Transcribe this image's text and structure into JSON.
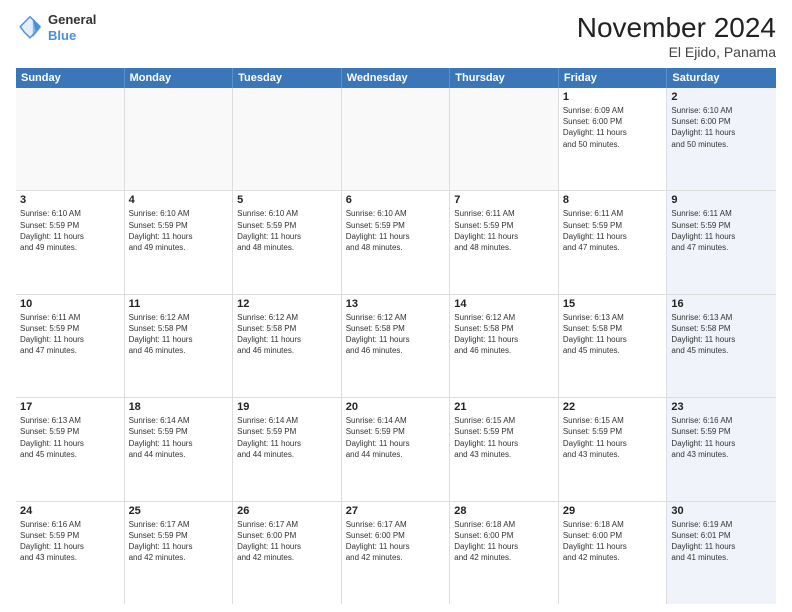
{
  "logo": {
    "general": "General",
    "blue": "Blue"
  },
  "header": {
    "month": "November 2024",
    "location": "El Ejido, Panama"
  },
  "weekdays": [
    "Sunday",
    "Monday",
    "Tuesday",
    "Wednesday",
    "Thursday",
    "Friday",
    "Saturday"
  ],
  "rows": [
    [
      {
        "day": "",
        "info": "",
        "empty": true
      },
      {
        "day": "",
        "info": "",
        "empty": true
      },
      {
        "day": "",
        "info": "",
        "empty": true
      },
      {
        "day": "",
        "info": "",
        "empty": true
      },
      {
        "day": "",
        "info": "",
        "empty": true
      },
      {
        "day": "1",
        "info": "Sunrise: 6:09 AM\nSunset: 6:00 PM\nDaylight: 11 hours\nand 50 minutes.",
        "empty": false
      },
      {
        "day": "2",
        "info": "Sunrise: 6:10 AM\nSunset: 6:00 PM\nDaylight: 11 hours\nand 50 minutes.",
        "empty": false,
        "alt": true
      }
    ],
    [
      {
        "day": "3",
        "info": "Sunrise: 6:10 AM\nSunset: 5:59 PM\nDaylight: 11 hours\nand 49 minutes.",
        "empty": false
      },
      {
        "day": "4",
        "info": "Sunrise: 6:10 AM\nSunset: 5:59 PM\nDaylight: 11 hours\nand 49 minutes.",
        "empty": false
      },
      {
        "day": "5",
        "info": "Sunrise: 6:10 AM\nSunset: 5:59 PM\nDaylight: 11 hours\nand 48 minutes.",
        "empty": false
      },
      {
        "day": "6",
        "info": "Sunrise: 6:10 AM\nSunset: 5:59 PM\nDaylight: 11 hours\nand 48 minutes.",
        "empty": false
      },
      {
        "day": "7",
        "info": "Sunrise: 6:11 AM\nSunset: 5:59 PM\nDaylight: 11 hours\nand 48 minutes.",
        "empty": false
      },
      {
        "day": "8",
        "info": "Sunrise: 6:11 AM\nSunset: 5:59 PM\nDaylight: 11 hours\nand 47 minutes.",
        "empty": false
      },
      {
        "day": "9",
        "info": "Sunrise: 6:11 AM\nSunset: 5:59 PM\nDaylight: 11 hours\nand 47 minutes.",
        "empty": false,
        "alt": true
      }
    ],
    [
      {
        "day": "10",
        "info": "Sunrise: 6:11 AM\nSunset: 5:59 PM\nDaylight: 11 hours\nand 47 minutes.",
        "empty": false
      },
      {
        "day": "11",
        "info": "Sunrise: 6:12 AM\nSunset: 5:58 PM\nDaylight: 11 hours\nand 46 minutes.",
        "empty": false
      },
      {
        "day": "12",
        "info": "Sunrise: 6:12 AM\nSunset: 5:58 PM\nDaylight: 11 hours\nand 46 minutes.",
        "empty": false
      },
      {
        "day": "13",
        "info": "Sunrise: 6:12 AM\nSunset: 5:58 PM\nDaylight: 11 hours\nand 46 minutes.",
        "empty": false
      },
      {
        "day": "14",
        "info": "Sunrise: 6:12 AM\nSunset: 5:58 PM\nDaylight: 11 hours\nand 46 minutes.",
        "empty": false
      },
      {
        "day": "15",
        "info": "Sunrise: 6:13 AM\nSunset: 5:58 PM\nDaylight: 11 hours\nand 45 minutes.",
        "empty": false
      },
      {
        "day": "16",
        "info": "Sunrise: 6:13 AM\nSunset: 5:58 PM\nDaylight: 11 hours\nand 45 minutes.",
        "empty": false,
        "alt": true
      }
    ],
    [
      {
        "day": "17",
        "info": "Sunrise: 6:13 AM\nSunset: 5:59 PM\nDaylight: 11 hours\nand 45 minutes.",
        "empty": false
      },
      {
        "day": "18",
        "info": "Sunrise: 6:14 AM\nSunset: 5:59 PM\nDaylight: 11 hours\nand 44 minutes.",
        "empty": false
      },
      {
        "day": "19",
        "info": "Sunrise: 6:14 AM\nSunset: 5:59 PM\nDaylight: 11 hours\nand 44 minutes.",
        "empty": false
      },
      {
        "day": "20",
        "info": "Sunrise: 6:14 AM\nSunset: 5:59 PM\nDaylight: 11 hours\nand 44 minutes.",
        "empty": false
      },
      {
        "day": "21",
        "info": "Sunrise: 6:15 AM\nSunset: 5:59 PM\nDaylight: 11 hours\nand 43 minutes.",
        "empty": false
      },
      {
        "day": "22",
        "info": "Sunrise: 6:15 AM\nSunset: 5:59 PM\nDaylight: 11 hours\nand 43 minutes.",
        "empty": false
      },
      {
        "day": "23",
        "info": "Sunrise: 6:16 AM\nSunset: 5:59 PM\nDaylight: 11 hours\nand 43 minutes.",
        "empty": false,
        "alt": true
      }
    ],
    [
      {
        "day": "24",
        "info": "Sunrise: 6:16 AM\nSunset: 5:59 PM\nDaylight: 11 hours\nand 43 minutes.",
        "empty": false
      },
      {
        "day": "25",
        "info": "Sunrise: 6:17 AM\nSunset: 5:59 PM\nDaylight: 11 hours\nand 42 minutes.",
        "empty": false
      },
      {
        "day": "26",
        "info": "Sunrise: 6:17 AM\nSunset: 6:00 PM\nDaylight: 11 hours\nand 42 minutes.",
        "empty": false
      },
      {
        "day": "27",
        "info": "Sunrise: 6:17 AM\nSunset: 6:00 PM\nDaylight: 11 hours\nand 42 minutes.",
        "empty": false
      },
      {
        "day": "28",
        "info": "Sunrise: 6:18 AM\nSunset: 6:00 PM\nDaylight: 11 hours\nand 42 minutes.",
        "empty": false
      },
      {
        "day": "29",
        "info": "Sunrise: 6:18 AM\nSunset: 6:00 PM\nDaylight: 11 hours\nand 42 minutes.",
        "empty": false
      },
      {
        "day": "30",
        "info": "Sunrise: 6:19 AM\nSunset: 6:01 PM\nDaylight: 11 hours\nand 41 minutes.",
        "empty": false,
        "alt": true
      }
    ]
  ]
}
